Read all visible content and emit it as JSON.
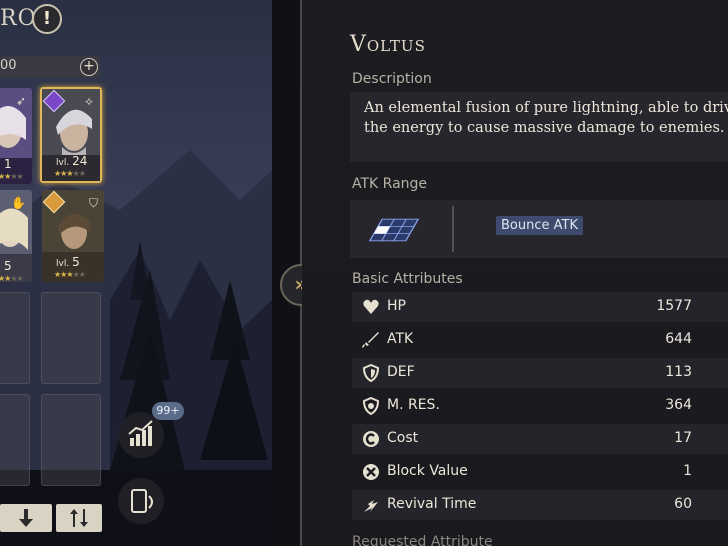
{
  "roster": {
    "title": "RO",
    "cost_value": "00",
    "cards": [
      {
        "level_prefix": "",
        "level": "1",
        "stars_filled": "★★",
        "stars_empty": "★★"
      },
      {
        "level_prefix": "lvl.",
        "level": "24",
        "stars_filled": "★★★",
        "stars_empty": "★★"
      },
      {
        "level_prefix": "",
        "level": "5",
        "stars_filled": "★★",
        "stars_empty": "★★"
      },
      {
        "level_prefix": "lvl.",
        "level": "5",
        "stars_filled": "★★★",
        "stars_empty": "★★"
      }
    ],
    "stats_badge": "99+"
  },
  "unit": {
    "name": "Voltus",
    "description_label": "Description",
    "description": "An elemental fusion of pure lightning, able to drive the energy to cause massive damage to enemies.",
    "atk_range_label": "ATK Range",
    "atk_type": "Bounce ATK",
    "basic_attributes_label": "Basic Attributes",
    "attributes": [
      {
        "label": "HP",
        "value": "1577",
        "icon": "heart-icon"
      },
      {
        "label": "ATK",
        "value": "644",
        "icon": "sword-icon"
      },
      {
        "label": "DEF",
        "value": "113",
        "icon": "shield-icon"
      },
      {
        "label": "M. RES.",
        "value": "364",
        "icon": "magic-shield-icon"
      },
      {
        "label": "Cost",
        "value": "17",
        "icon": "cost-icon"
      },
      {
        "label": "Block Value",
        "value": "1",
        "icon": "block-icon"
      },
      {
        "label": "Revival Time",
        "value": "60",
        "icon": "revival-icon"
      }
    ],
    "cutoff_label": "Requested Attribute"
  },
  "colors": {
    "accent": "#c9a86a",
    "panel": "#1c1c21",
    "tag": "#3e4a6e"
  }
}
